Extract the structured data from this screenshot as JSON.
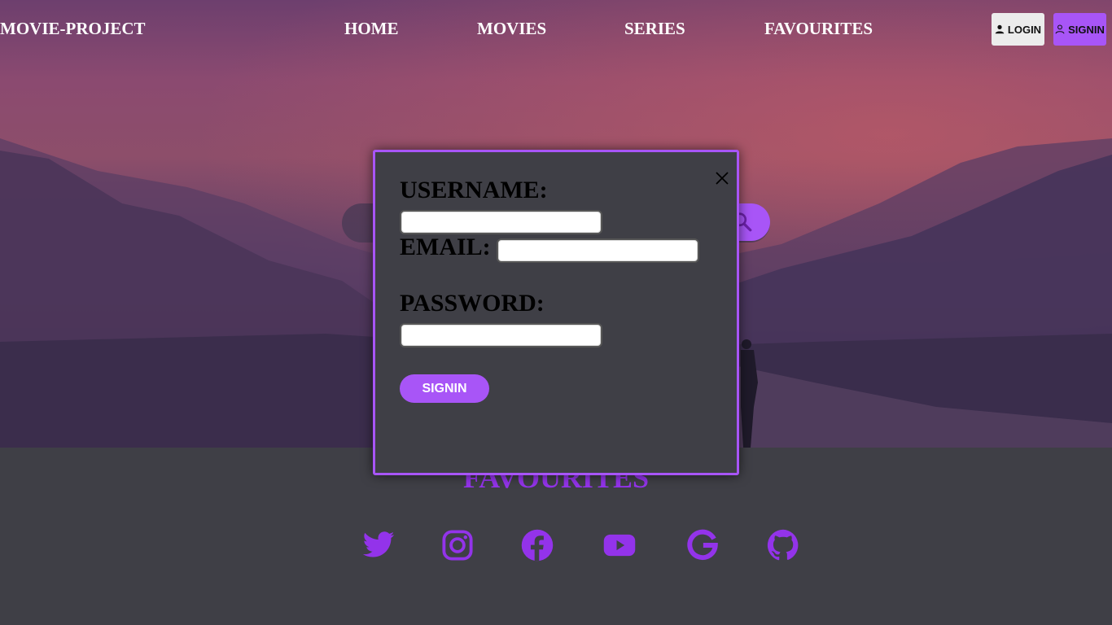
{
  "nav": {
    "brand": "MOVIE-PROJECT",
    "links": [
      "HOME",
      "MOVIES",
      "SERIES",
      "FAVOURITES"
    ],
    "login_label": "LOGIN",
    "signin_label": "SIGNIN"
  },
  "search": {
    "icon": "search-icon"
  },
  "footer": {
    "heading": "FAVOURITES",
    "socials": [
      "twitter-icon",
      "instagram-icon",
      "facebook-icon",
      "youtube-icon",
      "google-icon",
      "github-icon"
    ]
  },
  "modal": {
    "username_label": "USERNAME:",
    "email_label": "EMAIL:",
    "password_label": "PASSWORD:",
    "username_value": "",
    "email_value": "",
    "password_value": "",
    "submit_label": "SIGNIN",
    "close_icon": "close-icon"
  },
  "colors": {
    "accent": "#a855f7",
    "heading": "#9333ea",
    "page_bg": "#3f3f46",
    "modal_bg": "#3f3f46",
    "login_bg": "#ececec"
  }
}
